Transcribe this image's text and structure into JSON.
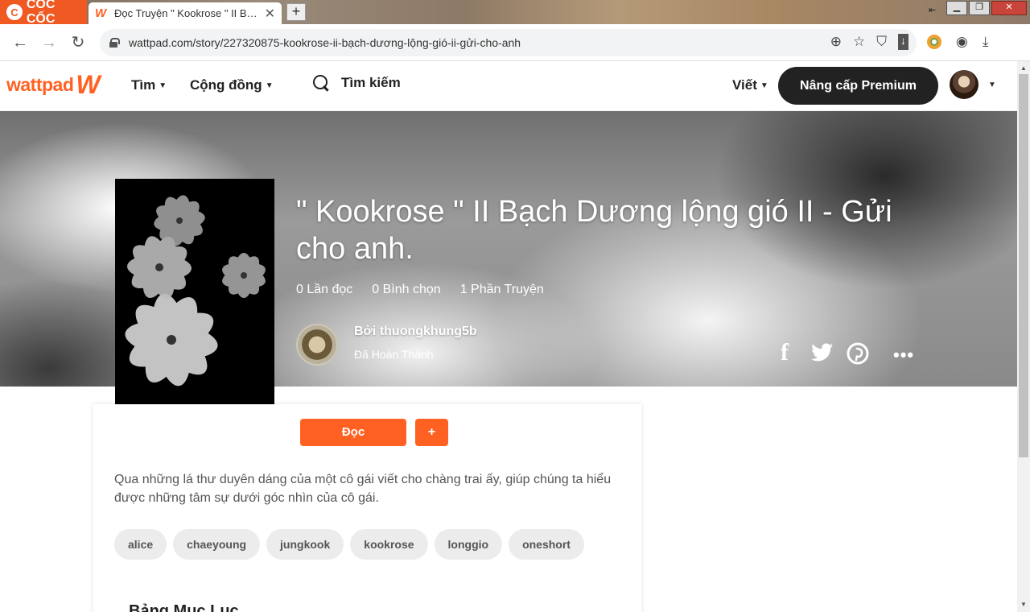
{
  "browser": {
    "brand": "CỐC CỐC",
    "tab_title": "Đọc Truyện \" Kookrose \" II Bạch Dương lộng gió II - Gửi cho anh",
    "new_tab": "+",
    "url": "wattpad.com/story/227320875-kookrose-ii-bạch-dương-lộng-gió-ii-gửi-cho-anh"
  },
  "header": {
    "logo_text": "wattpad",
    "logo_mark": "W",
    "menu": [
      {
        "label": "Tìm"
      },
      {
        "label": "Cộng đồng"
      }
    ],
    "search_label": "Tìm kiếm",
    "write_label": "Viết",
    "premium_label": "Nâng cấp Premium"
  },
  "story": {
    "title": "\" Kookrose \" II Bạch Dương lộng gió II - Gửi cho anh.",
    "stats": {
      "reads": "0 Lần đọc",
      "votes": "0 Bình chọn",
      "parts": "1 Phần Truyện"
    },
    "author_by": "Bởi thuongkhung5b",
    "status": "Đã Hoàn Thành",
    "read_button": "Đọc",
    "add_button": "+",
    "description": "Qua những lá thư duyên dáng của một cô gái viết cho chàng trai ấy, giúp chúng ta hiểu được những tâm sự dưới góc nhìn của cô gái.",
    "tags": [
      "alice",
      "chaeyoung",
      "jungkook",
      "kookrose",
      "longgio",
      "oneshort"
    ],
    "toc_heading": "Bảng Mục Lục"
  },
  "share": {
    "facebook": "f",
    "more": "•••"
  },
  "colors": {
    "accent": "#ff6122",
    "premium_bg": "#222222",
    "tag_bg": "#ececec"
  }
}
